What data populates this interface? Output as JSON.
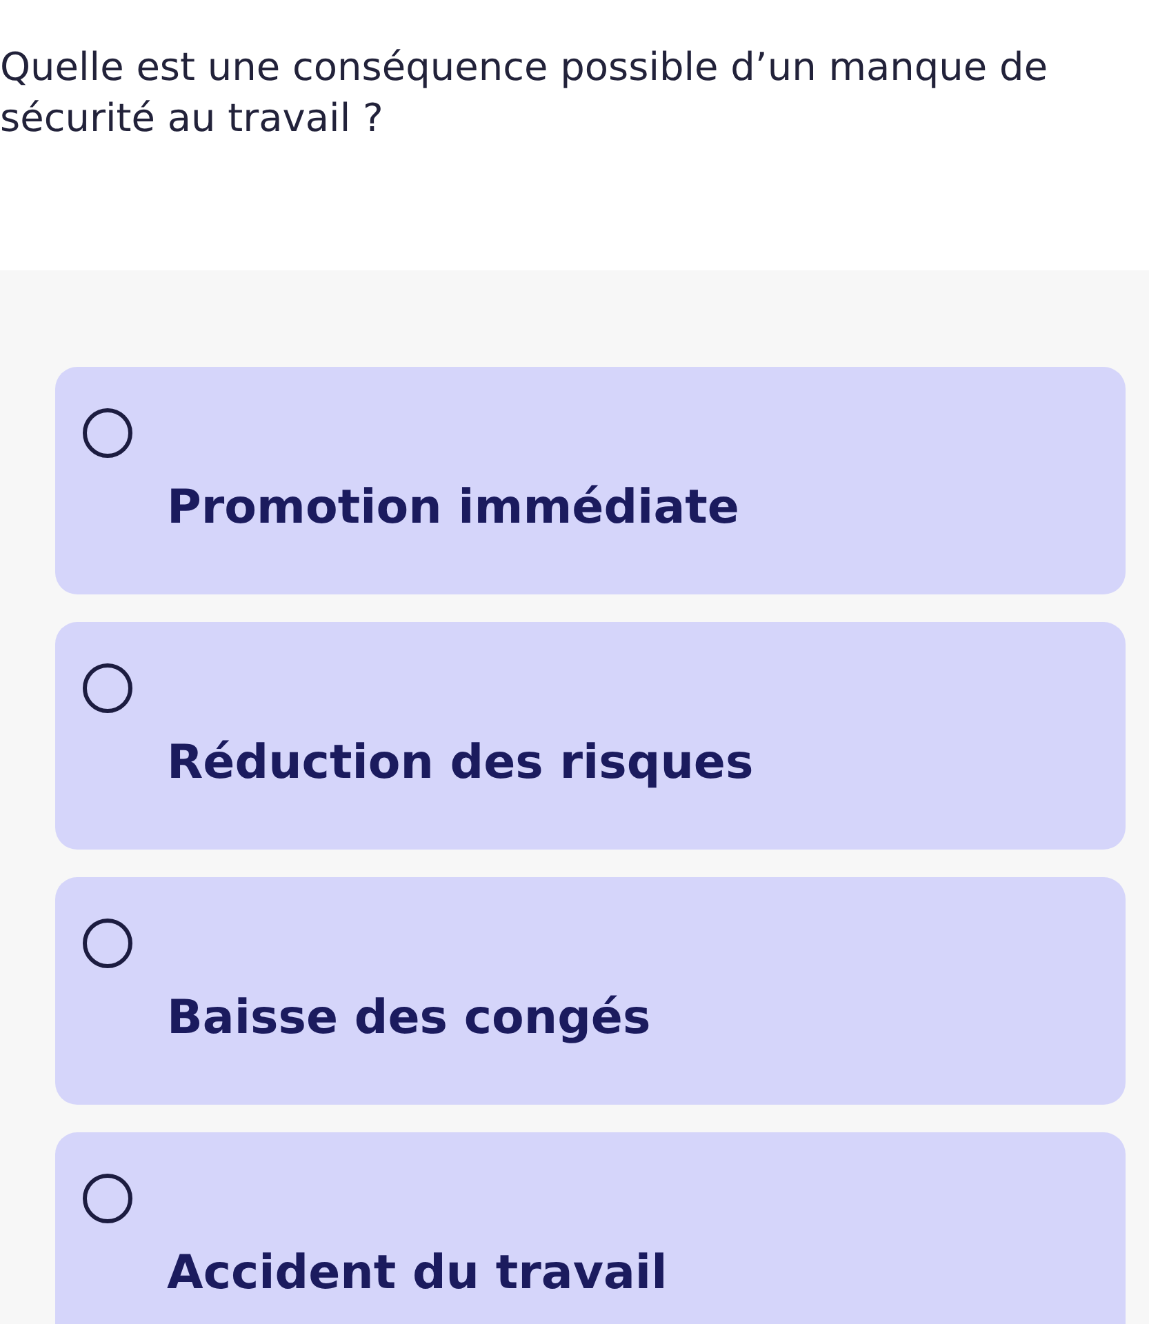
{
  "question": "Quelle est une conséquence possible d’un manque de sécurité au travail ?",
  "options": [
    {
      "label": "Promotion immédiate",
      "selected": false
    },
    {
      "label": "Réduction des risques",
      "selected": false
    },
    {
      "label": "Baisse des congés",
      "selected": false
    },
    {
      "label": "Accident du travail",
      "selected": false
    }
  ]
}
